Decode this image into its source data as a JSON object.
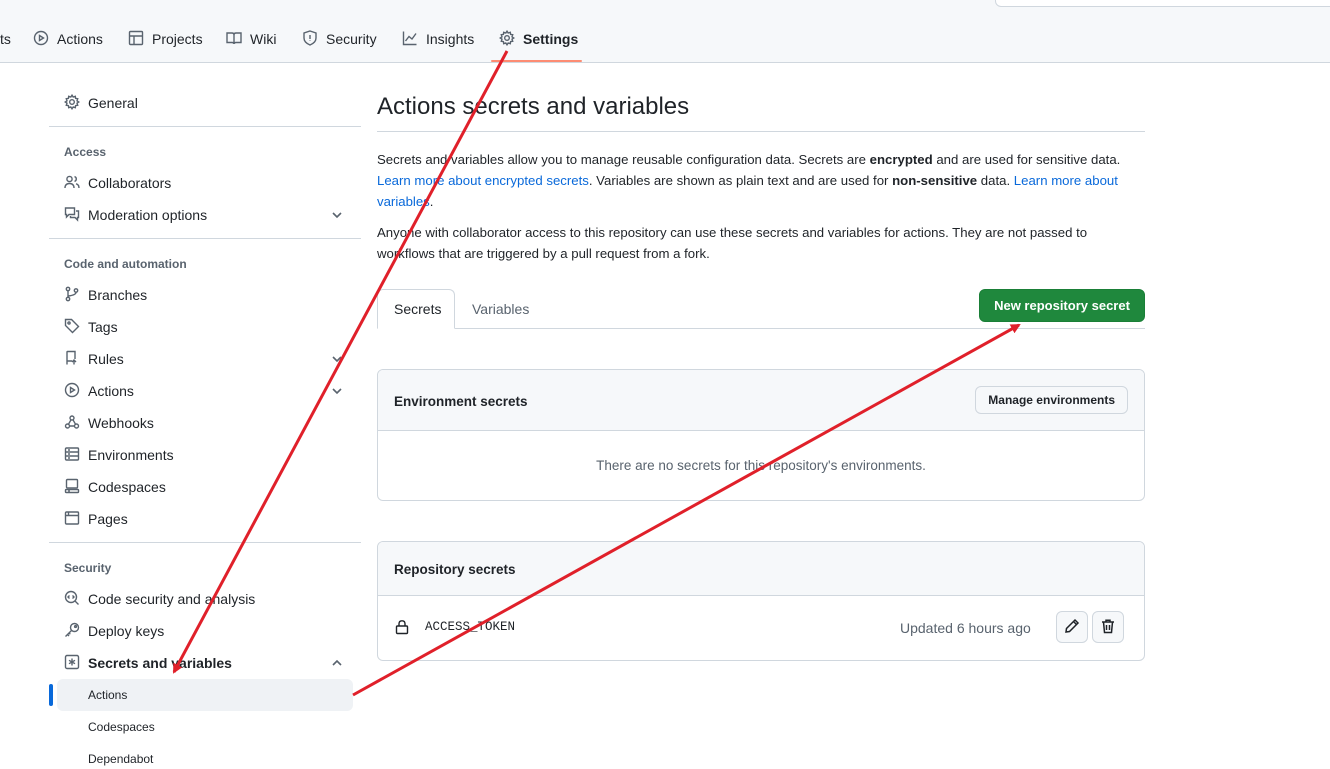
{
  "nav": {
    "partial_tab": "ts",
    "tabs": [
      {
        "label": "Actions",
        "icon": "play-circle-icon"
      },
      {
        "label": "Projects",
        "icon": "table-icon"
      },
      {
        "label": "Wiki",
        "icon": "book-icon"
      },
      {
        "label": "Security",
        "icon": "shield-icon"
      },
      {
        "label": "Insights",
        "icon": "graph-icon"
      },
      {
        "label": "Settings",
        "icon": "gear-icon",
        "selected": true
      }
    ]
  },
  "sidebar": {
    "general": "General",
    "access_heading": "Access",
    "access": [
      "Collaborators",
      "Moderation options"
    ],
    "code_heading": "Code and automation",
    "code": [
      "Branches",
      "Tags",
      "Rules",
      "Actions",
      "Webhooks",
      "Environments",
      "Codespaces",
      "Pages"
    ],
    "security_heading": "Security",
    "security": [
      "Code security and analysis",
      "Deploy keys",
      "Secrets and variables"
    ],
    "secrets_sub": [
      "Actions",
      "Codespaces",
      "Dependabot"
    ]
  },
  "main": {
    "title": "Actions secrets and variables",
    "p1": {
      "t1": "Secrets and variables allow you to manage reusable configuration data. Secrets are ",
      "b1": "encrypted",
      "t2": " and are used for sensitive data. ",
      "link1": "Learn more about encrypted secrets",
      "t3": ". Variables are shown as plain text and are used for ",
      "b2": "non-sensitive",
      "t4": " data. ",
      "link2": "Learn more about variables",
      "t5": "."
    },
    "p2": "Anyone with collaborator access to this repository can use these secrets and variables for actions. They are not passed to workflows that are triggered by a pull request from a fork.",
    "tabs": [
      "Secrets",
      "Variables"
    ],
    "new_secret_button": "New repository secret",
    "env_box": {
      "title": "Environment secrets",
      "button": "Manage environments",
      "empty": "There are no secrets for this repository's environments."
    },
    "repo_box": {
      "title": "Repository secrets",
      "secrets": [
        {
          "name": "ACCESS_TOKEN",
          "updated": "Updated 6 hours ago"
        }
      ]
    }
  },
  "annotation_color": "#e0202a"
}
